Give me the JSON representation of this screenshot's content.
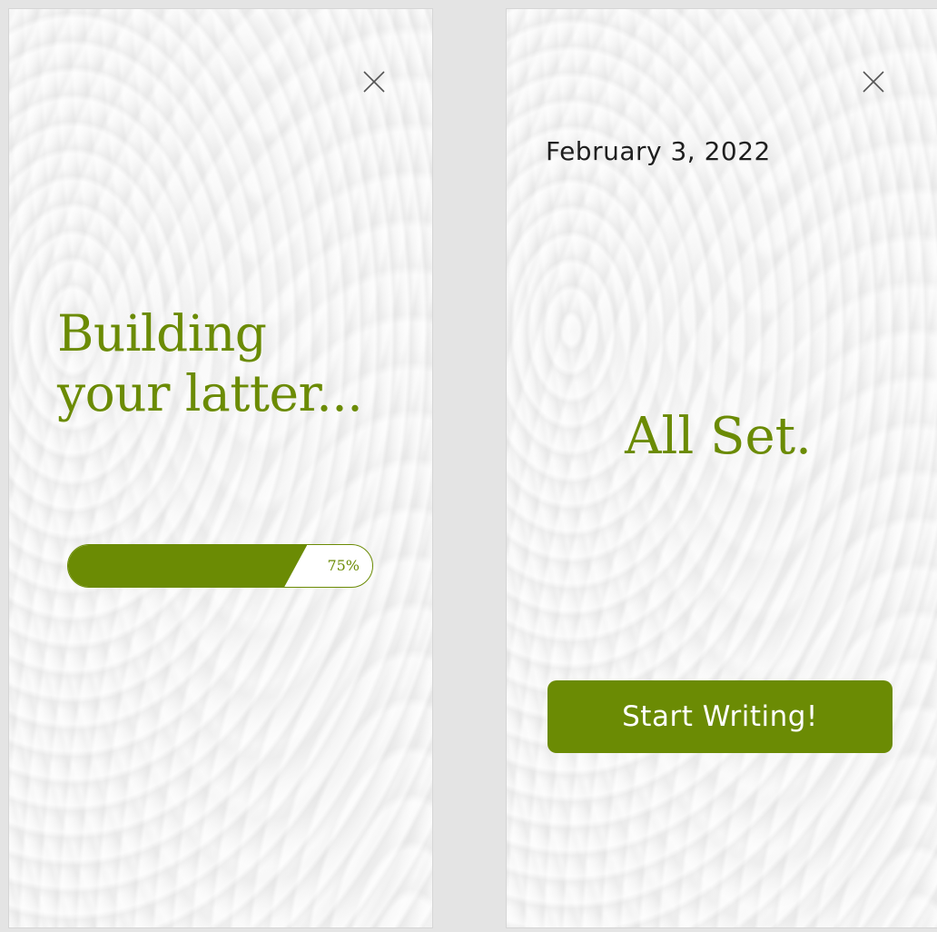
{
  "loading_screen": {
    "title_line1": "Building",
    "title_line2": "your latter...",
    "progress": {
      "percent": 75,
      "label": "75%"
    },
    "close_icon": "close-icon"
  },
  "done_screen": {
    "date": "February 3, 2022",
    "title": "All Set.",
    "start_button_label": "Start Writing!",
    "close_icon": "close-icon"
  },
  "colors": {
    "accent": "#6b8b04",
    "background": "#e4e4e4",
    "screen_background": "#f2f2f2",
    "text_dark": "#1f1f1f"
  }
}
